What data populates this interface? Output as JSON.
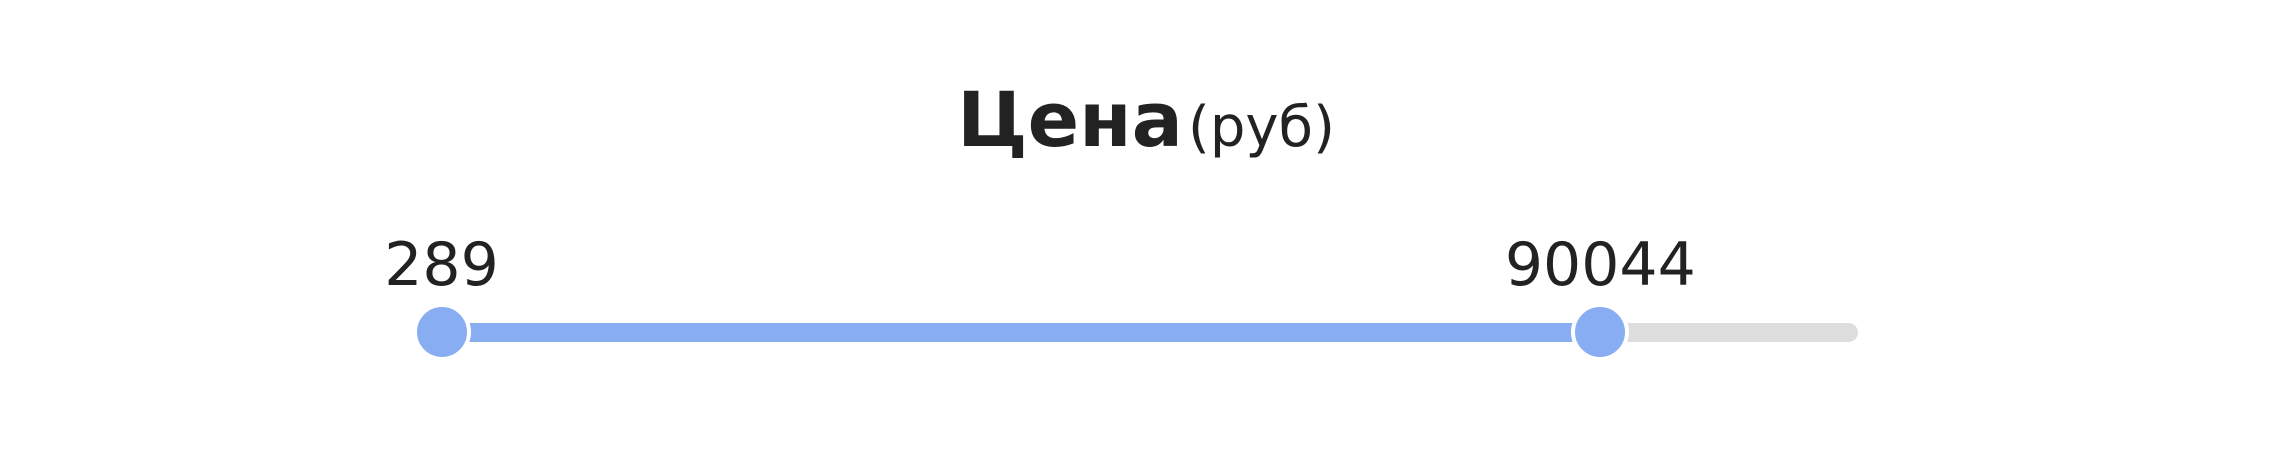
{
  "filter": {
    "title": "Цена",
    "unit": "(руб)"
  },
  "slider": {
    "track_min": 0,
    "track_max": 110000,
    "min_value": 289,
    "max_value": 90044,
    "min_label": "289",
    "max_label": "90044"
  },
  "colors": {
    "accent": "#89adf2",
    "track": "#dddddd",
    "text": "#222222",
    "background": "#ffffff"
  }
}
